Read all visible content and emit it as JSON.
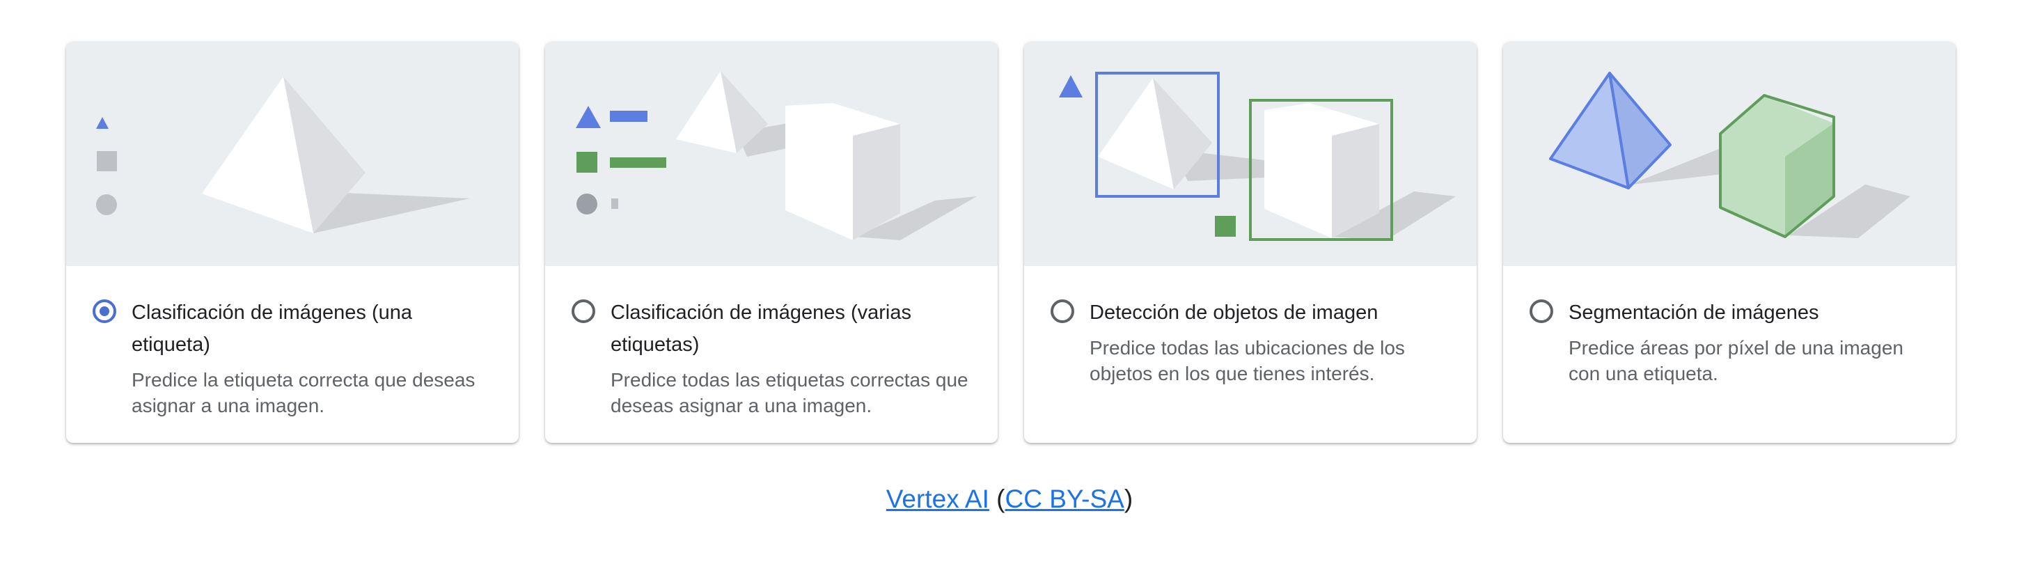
{
  "cards": [
    {
      "title": "Clasificación de imágenes (una etiqueta)",
      "description": "Predice la etiqueta correcta que deseas asignar a una imagen.",
      "selected": true
    },
    {
      "title": "Clasificación de imágenes (varias etiquetas)",
      "description": "Predice todas las etiquetas correctas que deseas asignar a una imagen.",
      "selected": false
    },
    {
      "title": "Detección de objetos de imagen",
      "description": "Predice todas las ubicaciones de los objetos en los que tienes interés.",
      "selected": false
    },
    {
      "title": "Segmentación de imágenes",
      "description": "Predice áreas por píxel de una imagen con una etiqueta.",
      "selected": false
    }
  ],
  "credit": {
    "author": "Vertex AI",
    "open_paren": "(",
    "license": "CC BY-SA",
    "close_paren": ")"
  },
  "colors": {
    "selected_radio": "#4a6fd0",
    "illustration_bg": "#ebeef0",
    "blue_label": "#5b7ee0",
    "green_label": "#5f9e5a",
    "link": "#1a73e8"
  }
}
